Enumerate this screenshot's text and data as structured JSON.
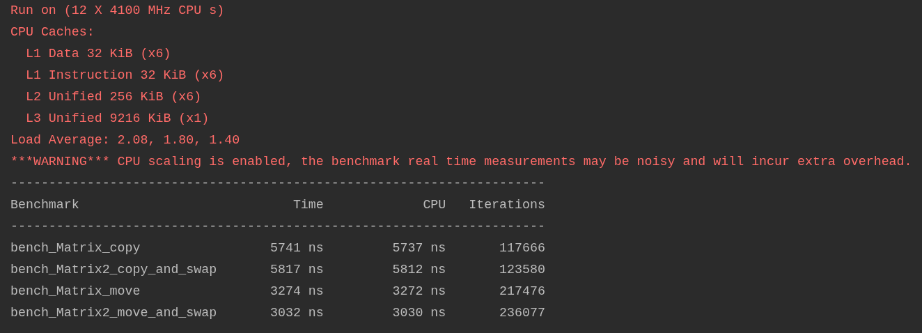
{
  "log": [
    {
      "kind": "stderr",
      "text": "Run on (12 X 4100 MHz CPU s)"
    },
    {
      "kind": "stderr",
      "text": "CPU Caches:",
      "children": [
        {
          "kind": "stderr",
          "text": "L1 Data 32 KiB (x6)"
        },
        {
          "kind": "stderr",
          "text": "L1 Instruction 32 KiB (x6)"
        },
        {
          "kind": "stderr",
          "text": "L2 Unified 256 KiB (x6)"
        },
        {
          "kind": "stderr",
          "text": "L3 Unified 9216 KiB (x1)"
        }
      ]
    },
    {
      "kind": "stderr",
      "text": "Load Average: 2.08, 1.80, 1.40"
    },
    {
      "kind": "stderr",
      "text": "***WARNING*** CPU scaling is enabled, the benchmark real time measurements may be noisy and will incur extra overhead."
    },
    {
      "kind": "stdout",
      "text": "----------------------------------------------------------------------"
    }
  ],
  "table": {
    "columns": [
      "Benchmark",
      "Time",
      "CPU",
      "Iterations"
    ],
    "separator": "----------------------------------------------------------------------",
    "rows": [
      [
        "bench_Matrix_copy",
        "5741 ns",
        "5737 ns",
        "117666"
      ],
      [
        "bench_Matrix2_copy_and_swap",
        "5817 ns",
        "5812 ns",
        "123580"
      ],
      [
        "bench_Matrix_move",
        "3274 ns",
        "3272 ns",
        "217476"
      ],
      [
        "bench_Matrix2_move_and_swap",
        "3032 ns",
        "3030 ns",
        "236077"
      ]
    ]
  }
}
